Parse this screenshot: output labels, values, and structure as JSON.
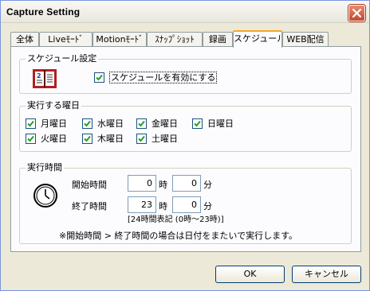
{
  "window": {
    "title": "Capture Setting"
  },
  "tabs": [
    {
      "label": "全体"
    },
    {
      "label": "Liveﾓｰﾄﾞ"
    },
    {
      "label": "Motionﾓｰﾄﾞ"
    },
    {
      "label": "ｽﾅｯﾌﾟｼｮｯﾄ"
    },
    {
      "label": "録画"
    },
    {
      "label": "スケジュール"
    },
    {
      "label": "WEB配信"
    }
  ],
  "active_tab": "スケジュール",
  "schedule_group": {
    "label": "スケジュール設定",
    "enable_label": "スケジュールを有効にする",
    "enable_checked": true,
    "icon": "calendar-icon"
  },
  "days_group": {
    "label": "実行する曜日",
    "days": [
      {
        "label": "月曜日",
        "checked": true
      },
      {
        "label": "水曜日",
        "checked": true
      },
      {
        "label": "金曜日",
        "checked": true
      },
      {
        "label": "日曜日",
        "checked": true
      },
      {
        "label": "火曜日",
        "checked": true
      },
      {
        "label": "木曜日",
        "checked": true
      },
      {
        "label": "土曜日",
        "checked": true
      }
    ]
  },
  "time_group": {
    "label": "実行時間",
    "icon": "clock-icon",
    "start_label": "開始時間",
    "start_hour": "0",
    "start_minute": "0",
    "end_label": "終了時間",
    "end_hour": "23",
    "end_minute": "0",
    "hour_unit": "時",
    "minute_unit": "分",
    "hint": "[24時間表記 (0時～23時)]",
    "note": "※開始時間 > 終了時間の場合は日付をまたいで実行します。"
  },
  "buttons": {
    "ok": "OK",
    "cancel": "キャンセル"
  },
  "colors": {
    "tab_highlight": "#f5a623",
    "check": "#21a121",
    "close_button": "#c44a2a"
  }
}
